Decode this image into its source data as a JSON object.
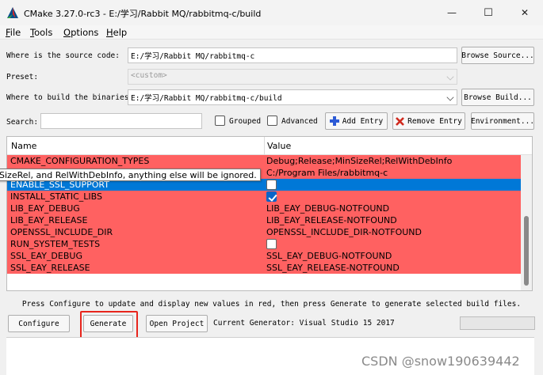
{
  "window": {
    "title": "CMake 3.27.0-rc3 - E:/学习/Rabbit MQ/rabbitmq-c/build",
    "minimize": "—",
    "maximize": "☐",
    "close": "✕"
  },
  "menu": [
    "File",
    "Tools",
    "Options",
    "Help"
  ],
  "source": {
    "label": "Where is the source code:",
    "value": "E:/学习/Rabbit MQ/rabbitmq-c",
    "button": "Browse Source..."
  },
  "preset": {
    "label": "Preset:",
    "value": "<custom>"
  },
  "build": {
    "label": "Where to build the binaries:",
    "value": "E:/学习/Rabbit MQ/rabbitmq-c/build",
    "button": "Browse Build..."
  },
  "search": {
    "label": "Search:",
    "value": "",
    "grouped": "Grouped",
    "advanced": "Advanced",
    "add_entry": "Add Entry",
    "remove_entry": "Remove Entry",
    "environment": "Environment..."
  },
  "table": {
    "headers": {
      "name": "Name",
      "value": "Value"
    },
    "rows": [
      {
        "name": "CMAKE_CONFIGURATION_TYPES",
        "value": "Debug;Release;MinSizeRel;RelWithDebInfo"
      },
      {
        "name": "",
        "value": "C:/Program Files/rabbitmq-c"
      },
      {
        "name": "ENABLE_SSL_SUPPORT",
        "checkbox": "unchecked"
      },
      {
        "name": "INSTALL_STATIC_LIBS",
        "checkbox": "checked"
      },
      {
        "name": "LIB_EAY_DEBUG",
        "value": "LIB_EAY_DEBUG-NOTFOUND"
      },
      {
        "name": "LIB_EAY_RELEASE",
        "value": "LIB_EAY_RELEASE-NOTFOUND"
      },
      {
        "name": "OPENSSL_INCLUDE_DIR",
        "value": "OPENSSL_INCLUDE_DIR-NOTFOUND"
      },
      {
        "name": "RUN_SYSTEM_TESTS",
        "checkbox": "unchecked"
      },
      {
        "name": "SSL_EAY_DEBUG",
        "value": "SSL_EAY_DEBUG-NOTFOUND"
      },
      {
        "name": "SSL_EAY_RELEASE",
        "value": "SSL_EAY_RELEASE-NOTFOUND"
      }
    ],
    "tooltip": "SizeRel, and RelWithDebInfo, anything else will be ignored."
  },
  "hint": "Press Configure to update and display new values in red, then press Generate to generate selected build files.",
  "actions": {
    "configure": "Configure",
    "generate": "Generate",
    "open_project": "Open Project",
    "generator": "Current Generator: Visual Studio 15 2017"
  },
  "watermark": "CSDN @snow190639442",
  "colors": {
    "changed_row": "#ff6161",
    "selection": "#0078d7",
    "annotation": "#e8251c"
  }
}
